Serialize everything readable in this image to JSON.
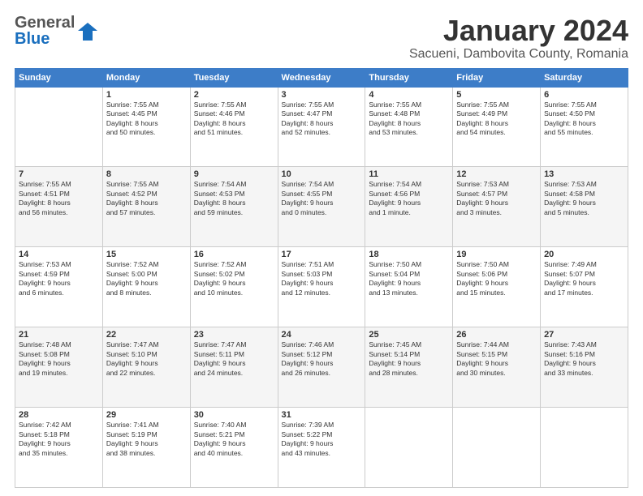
{
  "header": {
    "logo_general": "General",
    "logo_blue": "Blue",
    "month": "January 2024",
    "location": "Sacueni, Dambovita County, Romania"
  },
  "weekdays": [
    "Sunday",
    "Monday",
    "Tuesday",
    "Wednesday",
    "Thursday",
    "Friday",
    "Saturday"
  ],
  "weeks": [
    [
      {
        "day": "",
        "content": ""
      },
      {
        "day": "1",
        "content": "Sunrise: 7:55 AM\nSunset: 4:45 PM\nDaylight: 8 hours\nand 50 minutes."
      },
      {
        "day": "2",
        "content": "Sunrise: 7:55 AM\nSunset: 4:46 PM\nDaylight: 8 hours\nand 51 minutes."
      },
      {
        "day": "3",
        "content": "Sunrise: 7:55 AM\nSunset: 4:47 PM\nDaylight: 8 hours\nand 52 minutes."
      },
      {
        "day": "4",
        "content": "Sunrise: 7:55 AM\nSunset: 4:48 PM\nDaylight: 8 hours\nand 53 minutes."
      },
      {
        "day": "5",
        "content": "Sunrise: 7:55 AM\nSunset: 4:49 PM\nDaylight: 8 hours\nand 54 minutes."
      },
      {
        "day": "6",
        "content": "Sunrise: 7:55 AM\nSunset: 4:50 PM\nDaylight: 8 hours\nand 55 minutes."
      }
    ],
    [
      {
        "day": "7",
        "content": "Sunrise: 7:55 AM\nSunset: 4:51 PM\nDaylight: 8 hours\nand 56 minutes."
      },
      {
        "day": "8",
        "content": "Sunrise: 7:55 AM\nSunset: 4:52 PM\nDaylight: 8 hours\nand 57 minutes."
      },
      {
        "day": "9",
        "content": "Sunrise: 7:54 AM\nSunset: 4:53 PM\nDaylight: 8 hours\nand 59 minutes."
      },
      {
        "day": "10",
        "content": "Sunrise: 7:54 AM\nSunset: 4:55 PM\nDaylight: 9 hours\nand 0 minutes."
      },
      {
        "day": "11",
        "content": "Sunrise: 7:54 AM\nSunset: 4:56 PM\nDaylight: 9 hours\nand 1 minute."
      },
      {
        "day": "12",
        "content": "Sunrise: 7:53 AM\nSunset: 4:57 PM\nDaylight: 9 hours\nand 3 minutes."
      },
      {
        "day": "13",
        "content": "Sunrise: 7:53 AM\nSunset: 4:58 PM\nDaylight: 9 hours\nand 5 minutes."
      }
    ],
    [
      {
        "day": "14",
        "content": "Sunrise: 7:53 AM\nSunset: 4:59 PM\nDaylight: 9 hours\nand 6 minutes."
      },
      {
        "day": "15",
        "content": "Sunrise: 7:52 AM\nSunset: 5:00 PM\nDaylight: 9 hours\nand 8 minutes."
      },
      {
        "day": "16",
        "content": "Sunrise: 7:52 AM\nSunset: 5:02 PM\nDaylight: 9 hours\nand 10 minutes."
      },
      {
        "day": "17",
        "content": "Sunrise: 7:51 AM\nSunset: 5:03 PM\nDaylight: 9 hours\nand 12 minutes."
      },
      {
        "day": "18",
        "content": "Sunrise: 7:50 AM\nSunset: 5:04 PM\nDaylight: 9 hours\nand 13 minutes."
      },
      {
        "day": "19",
        "content": "Sunrise: 7:50 AM\nSunset: 5:06 PM\nDaylight: 9 hours\nand 15 minutes."
      },
      {
        "day": "20",
        "content": "Sunrise: 7:49 AM\nSunset: 5:07 PM\nDaylight: 9 hours\nand 17 minutes."
      }
    ],
    [
      {
        "day": "21",
        "content": "Sunrise: 7:48 AM\nSunset: 5:08 PM\nDaylight: 9 hours\nand 19 minutes."
      },
      {
        "day": "22",
        "content": "Sunrise: 7:47 AM\nSunset: 5:10 PM\nDaylight: 9 hours\nand 22 minutes."
      },
      {
        "day": "23",
        "content": "Sunrise: 7:47 AM\nSunset: 5:11 PM\nDaylight: 9 hours\nand 24 minutes."
      },
      {
        "day": "24",
        "content": "Sunrise: 7:46 AM\nSunset: 5:12 PM\nDaylight: 9 hours\nand 26 minutes."
      },
      {
        "day": "25",
        "content": "Sunrise: 7:45 AM\nSunset: 5:14 PM\nDaylight: 9 hours\nand 28 minutes."
      },
      {
        "day": "26",
        "content": "Sunrise: 7:44 AM\nSunset: 5:15 PM\nDaylight: 9 hours\nand 30 minutes."
      },
      {
        "day": "27",
        "content": "Sunrise: 7:43 AM\nSunset: 5:16 PM\nDaylight: 9 hours\nand 33 minutes."
      }
    ],
    [
      {
        "day": "28",
        "content": "Sunrise: 7:42 AM\nSunset: 5:18 PM\nDaylight: 9 hours\nand 35 minutes."
      },
      {
        "day": "29",
        "content": "Sunrise: 7:41 AM\nSunset: 5:19 PM\nDaylight: 9 hours\nand 38 minutes."
      },
      {
        "day": "30",
        "content": "Sunrise: 7:40 AM\nSunset: 5:21 PM\nDaylight: 9 hours\nand 40 minutes."
      },
      {
        "day": "31",
        "content": "Sunrise: 7:39 AM\nSunset: 5:22 PM\nDaylight: 9 hours\nand 43 minutes."
      },
      {
        "day": "",
        "content": ""
      },
      {
        "day": "",
        "content": ""
      },
      {
        "day": "",
        "content": ""
      }
    ]
  ]
}
